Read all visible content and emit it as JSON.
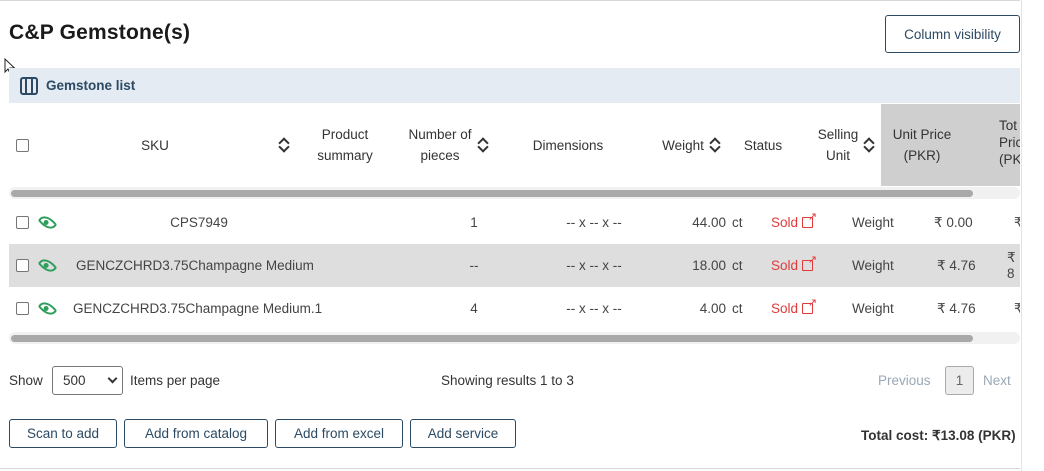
{
  "page": {
    "title": "C&P Gemstone(s)",
    "column_visibility_label": "Column visibility",
    "list_bar_label": "Gemstone list"
  },
  "table": {
    "headers": {
      "sku": "SKU",
      "product_summary_1": "Product",
      "product_summary_2": "summary",
      "pieces_1": "Number of",
      "pieces_2": "pieces",
      "dimensions": "Dimensions",
      "weight": "Weight",
      "status": "Status",
      "selling_unit_1": "Selling",
      "selling_unit_2": "Unit",
      "unit_price_1": "Unit Price",
      "unit_price_2": "(PKR)",
      "total_price_1": "Tot",
      "total_price_2": "Pric",
      "total_price_3": "(PK"
    },
    "rows": [
      {
        "sku": "CPS7949",
        "pieces": "1",
        "dimensions": "-- x -- x --",
        "weight": "44.00",
        "weight_unit": "ct",
        "status": "Sold",
        "selling_unit": "Weight",
        "unit_price": "₹ 0.00",
        "total_price": "₹"
      },
      {
        "sku": "GENCZCHRD3.75Champagne Medium",
        "pieces": "--",
        "dimensions": "-- x -- x --",
        "weight": "18.00",
        "weight_unit": "ct",
        "status": "Sold",
        "selling_unit": "Weight",
        "unit_price": "₹ 4.76",
        "total_price": "₹ 8"
      },
      {
        "sku": "GENCZCHRD3.75Champagne Medium.1",
        "pieces": "4",
        "dimensions": "-- x -- x --",
        "weight": "4.00",
        "weight_unit": "ct",
        "status": "Sold",
        "selling_unit": "Weight",
        "unit_price": "₹ 4.76",
        "total_price": "₹"
      }
    ]
  },
  "footer": {
    "show_label": "Show",
    "page_size": "500",
    "items_per_page_label": "Items per page",
    "showing_results": "Showing results 1 to 3",
    "previous_label": "Previous",
    "current_page": "1",
    "next_label": "Next"
  },
  "actions": {
    "scan_to_add": "Scan to add",
    "add_from_catalog": "Add from catalog",
    "add_from_excel": "Add from excel",
    "add_service": "Add service",
    "total_cost": "Total cost: ₹13.08 (PKR)"
  },
  "colors": {
    "accent": "#2c4a63",
    "list_bar_bg": "#e4ebf3",
    "sold": "#e03b3b",
    "eye": "#2e9e5b"
  },
  "icons": [
    "cursor-icon",
    "columns-icon",
    "sort-icon",
    "eye-icon",
    "external-link-icon",
    "chevron-down-icon"
  ]
}
